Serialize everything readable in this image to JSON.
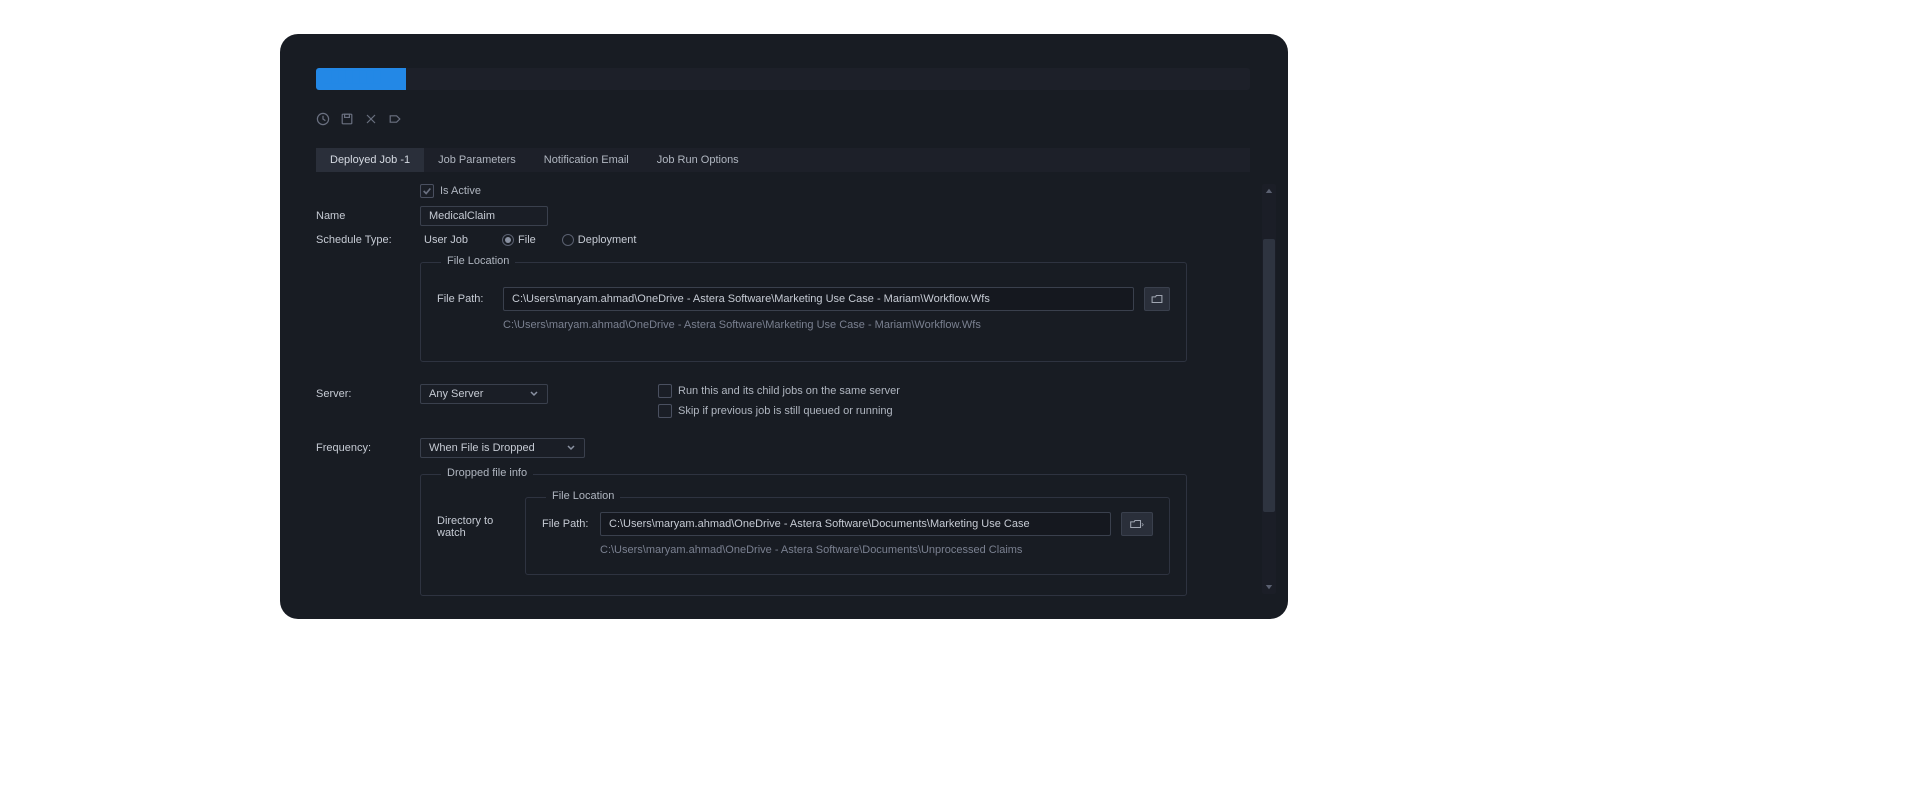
{
  "topbar": {
    "placeholder": ""
  },
  "tabs": [
    {
      "label": "Deployed Job -1"
    },
    {
      "label": "Job Parameters"
    },
    {
      "label": "Notification Email"
    },
    {
      "label": "Job Run Options"
    }
  ],
  "form": {
    "isActiveLabel": "Is Active",
    "nameLabel": "Name",
    "nameValue": "MedicalClaim",
    "scheduleTypeLabel": "Schedule Type:",
    "scheduleTypes": {
      "userJob": "User Job",
      "file": "File",
      "deployment": "Deployment"
    },
    "fileLocation1": {
      "legend": "File Location",
      "filePathLabel": "File Path:",
      "filePathValue": "C:\\Users\\maryam.ahmad\\OneDrive - Astera Software\\Marketing Use Case - Mariam\\Workflow.Wfs",
      "filePathSub": "C:\\Users\\maryam.ahmad\\OneDrive - Astera Software\\Marketing Use Case - Mariam\\Workflow.Wfs"
    },
    "serverLabel": "Server:",
    "serverValue": "Any Server",
    "runSameServerLabel": "Run this and its child jobs on the same server",
    "skipQueuedLabel": "Skip if previous job is still queued or running",
    "frequencyLabel": "Frequency:",
    "frequencyValue": "When File is Dropped",
    "droppedFileInfo": {
      "legend": "Dropped file info",
      "directoryLabel": "Directory to watch",
      "fileLocation": {
        "legend": "File Location",
        "filePathLabel": "File Path:",
        "filePathValue": "C:\\Users\\maryam.ahmad\\OneDrive - Astera Software\\Documents\\Marketing Use Case",
        "filePathSub": "C:\\Users\\maryam.ahmad\\OneDrive - Astera Software\\Documents\\Unprocessed Claims"
      }
    }
  }
}
